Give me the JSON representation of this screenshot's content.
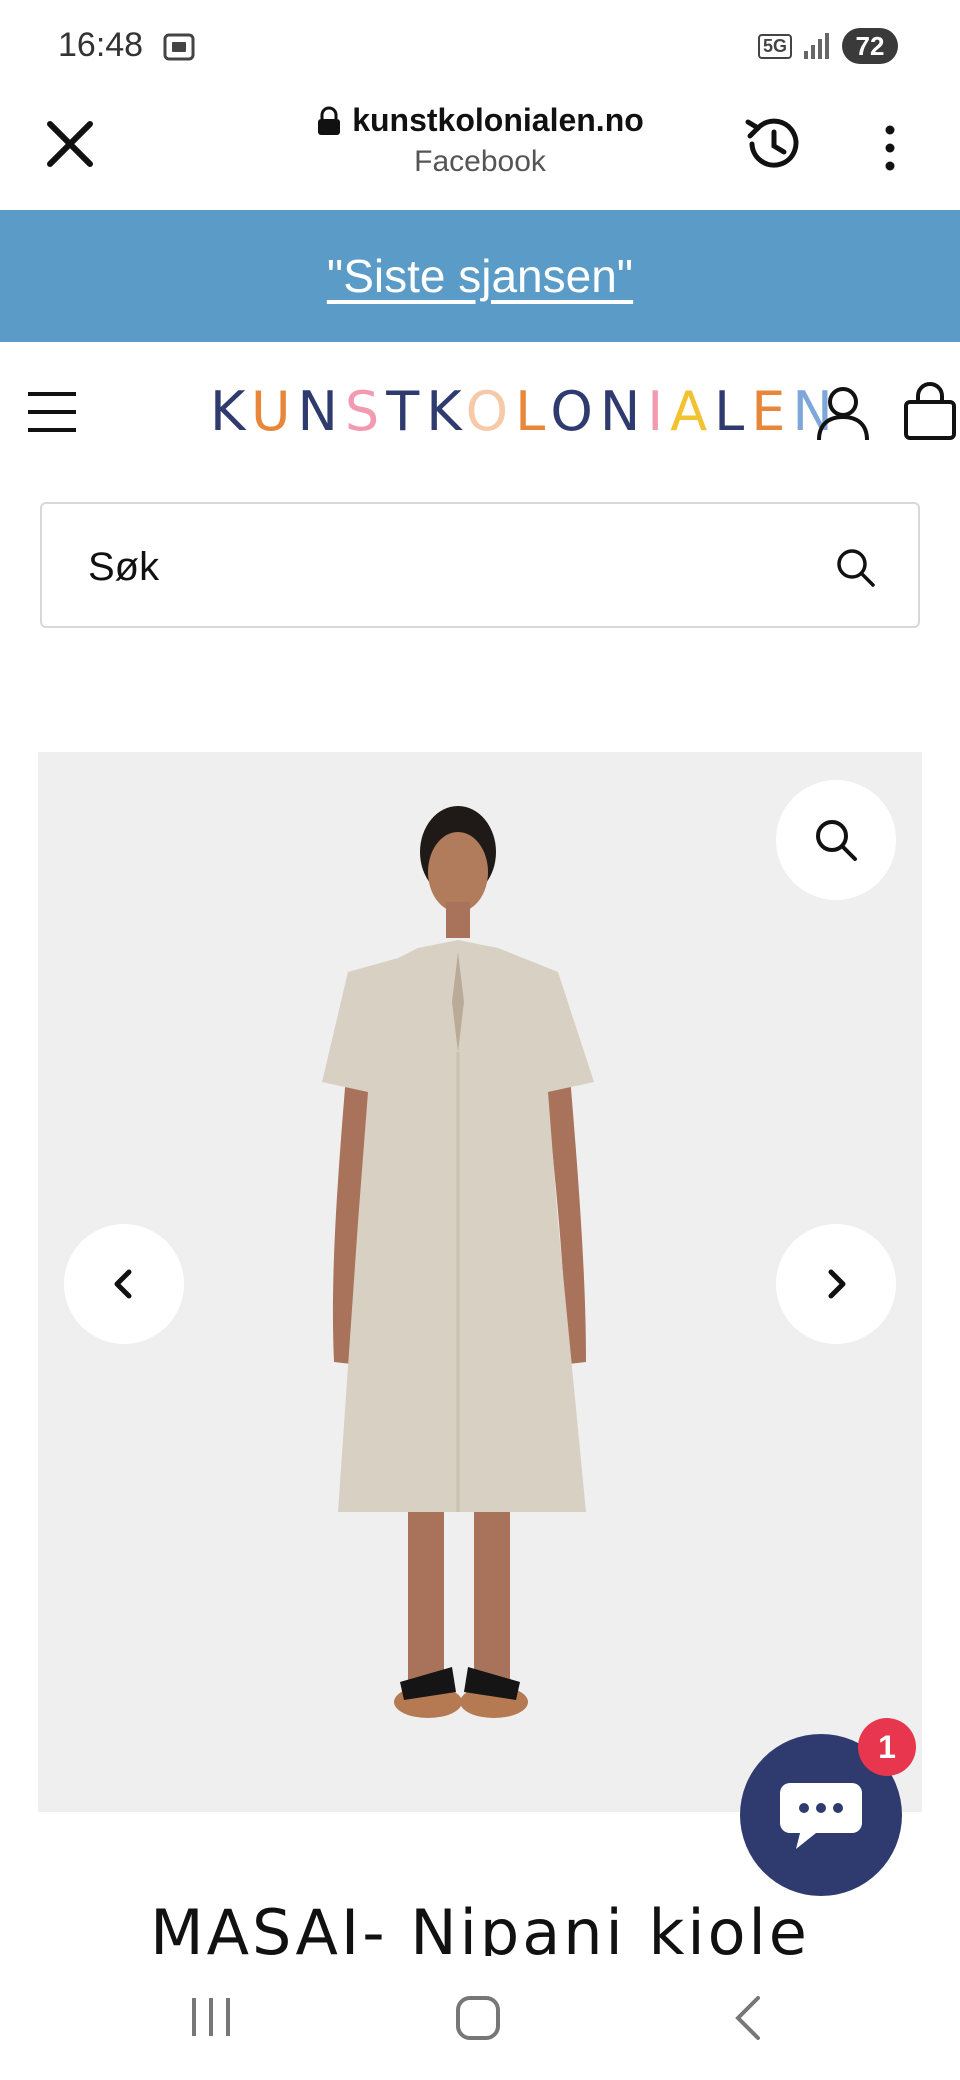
{
  "status_bar": {
    "time": "16:48",
    "network": "5G",
    "battery": "72"
  },
  "browser": {
    "url": "kunstkolonialen.no",
    "referrer": "Facebook",
    "icons": [
      "close-icon",
      "lock-icon",
      "history-icon",
      "more-vert-icon"
    ]
  },
  "announcement": {
    "text": "\"Siste sjansen\""
  },
  "header": {
    "logo_letters": [
      {
        "char": "K",
        "color": "#2f3b6e"
      },
      {
        "char": "U",
        "color": "#e8863a"
      },
      {
        "char": "N",
        "color": "#2f3b6e"
      },
      {
        "char": "S",
        "color": "#f29bb0"
      },
      {
        "char": "T",
        "color": "#2f3b6e"
      },
      {
        "char": "K",
        "color": "#2f3b6e"
      },
      {
        "char": "O",
        "color": "#f6c9a8"
      },
      {
        "char": "L",
        "color": "#e8863a"
      },
      {
        "char": "O",
        "color": "#2f3b6e"
      },
      {
        "char": "N",
        "color": "#2f3b6e"
      },
      {
        "char": "I",
        "color": "#f29bb0"
      },
      {
        "char": "A",
        "color": "#f2c230"
      },
      {
        "char": "L",
        "color": "#2f3b6e"
      },
      {
        "char": "E",
        "color": "#e8863a"
      },
      {
        "char": "N",
        "color": "#7ea6d8"
      }
    ],
    "icons": [
      "menu-icon",
      "account-icon",
      "cart-icon"
    ]
  },
  "search": {
    "placeholder": "Søk"
  },
  "product": {
    "title": "MASAI- Nipani kiole",
    "gallery_icons": [
      "zoom-icon",
      "chevron-left-icon",
      "chevron-right-icon"
    ]
  },
  "chat": {
    "badge": "1"
  },
  "colors": {
    "announcement_bg": "#5a9bc7",
    "chat_bg": "#2f3b6e",
    "badge_bg": "#e8364f"
  }
}
